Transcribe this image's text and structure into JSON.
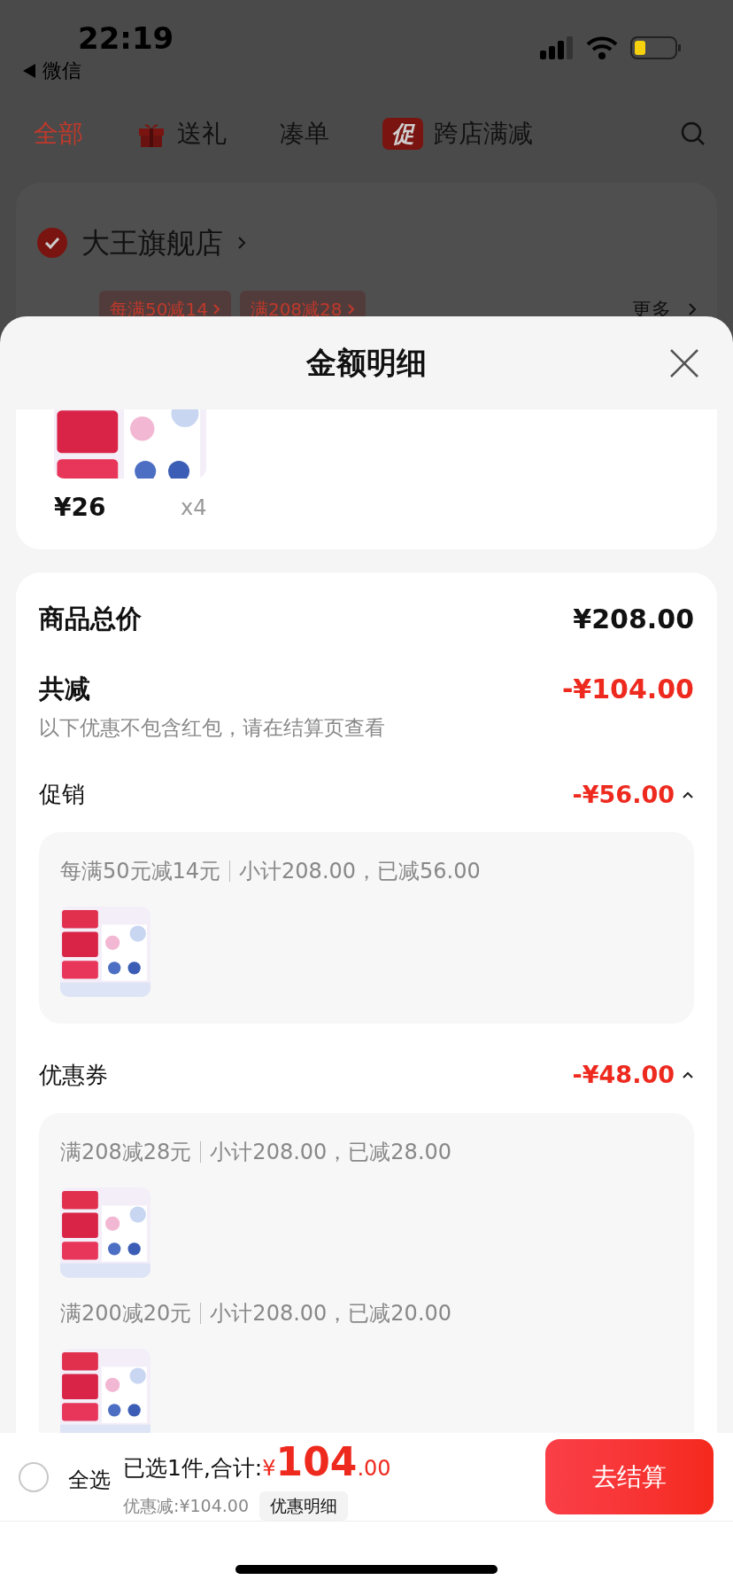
{
  "status_bar": {
    "time": "22:19",
    "back_label": "微信"
  },
  "tabs": [
    {
      "kind": "plain",
      "label": "全部",
      "selected": true
    },
    {
      "kind": "gift",
      "label": "送礼",
      "selected": false
    },
    {
      "kind": "plain",
      "label": "凑单",
      "selected": false
    },
    {
      "kind": "badge",
      "badge": "促",
      "label": "跨店满减",
      "selected": false
    }
  ],
  "store": {
    "name": "大王旗舰店",
    "checked": true,
    "promos": [
      "每满50减14",
      "满208减28"
    ],
    "more": "更多"
  },
  "sheet": {
    "title": "金额明细",
    "product": {
      "price": "¥26",
      "quantity": "x4"
    },
    "total": {
      "label": "商品总价",
      "value": "¥208.00"
    },
    "discount": {
      "label": "共减",
      "value": "-¥104.00",
      "note": "以下优惠不包含红包，请在结算页查看"
    },
    "sections": [
      {
        "label": "促销",
        "value": "-¥56.00",
        "expanded": true,
        "items": [
          {
            "rule": "每满50元减14元",
            "detail": "小计208.00，已减56.00"
          }
        ]
      },
      {
        "label": "优惠券",
        "value": "-¥48.00",
        "expanded": true,
        "items": [
          {
            "rule": "满208减28元",
            "detail": "小计208.00，已减28.00"
          },
          {
            "rule": "满200减20元",
            "detail": "小计208.00，已减20.00"
          }
        ]
      }
    ]
  },
  "footer": {
    "select_all": {
      "label": "全选",
      "checked": false
    },
    "selected_text": "已选1件,合计:",
    "currency": "¥",
    "amount_int": "104",
    "amount_dec": ".00",
    "saved": "优惠减:¥104.00",
    "detail_chip": "优惠明细",
    "checkout": "去结算"
  }
}
